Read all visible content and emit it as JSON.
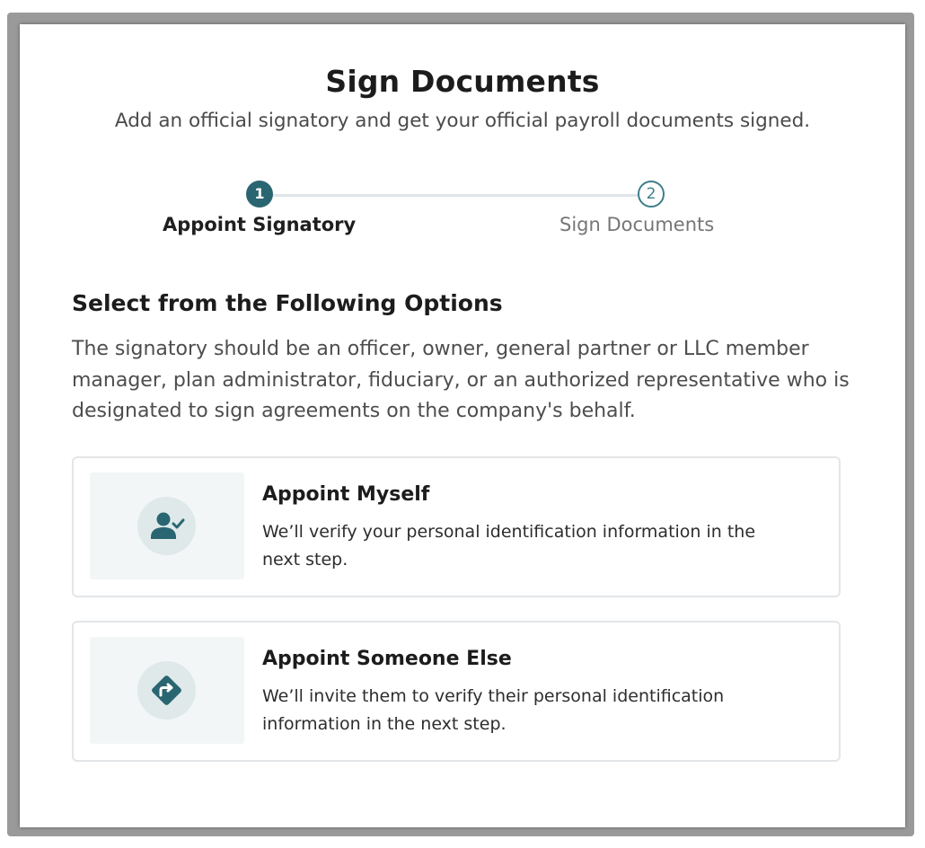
{
  "page": {
    "title": "Sign Documents",
    "subtitle": "Add an official signatory and get your official payroll documents signed."
  },
  "stepper": {
    "steps": [
      {
        "number": "1",
        "label": "Appoint Signatory",
        "state": "active"
      },
      {
        "number": "2",
        "label": "Sign Documents",
        "state": "inactive"
      }
    ]
  },
  "section": {
    "heading": "Select from the Following Options",
    "description": "The signatory should be an officer, owner, general partner or LLC member manager, plan administrator, fiduciary, or an authorized representative who is designated to sign agreements on the company's behalf."
  },
  "options": [
    {
      "title": "Appoint Myself",
      "description": "We’ll verify your personal identification information in the next step.",
      "icon": "user-check-icon"
    },
    {
      "title": "Appoint Someone Else",
      "description": "We’ll invite them to verify their personal identification information in the next step.",
      "icon": "redirect-diamond-icon"
    }
  ],
  "colors": {
    "accent": "#2a6671",
    "step_inactive": "#3d7f89",
    "icon_bg": "#dfe9ea",
    "panel_bg": "#f3f6f7",
    "border": "#e3e6e8"
  }
}
